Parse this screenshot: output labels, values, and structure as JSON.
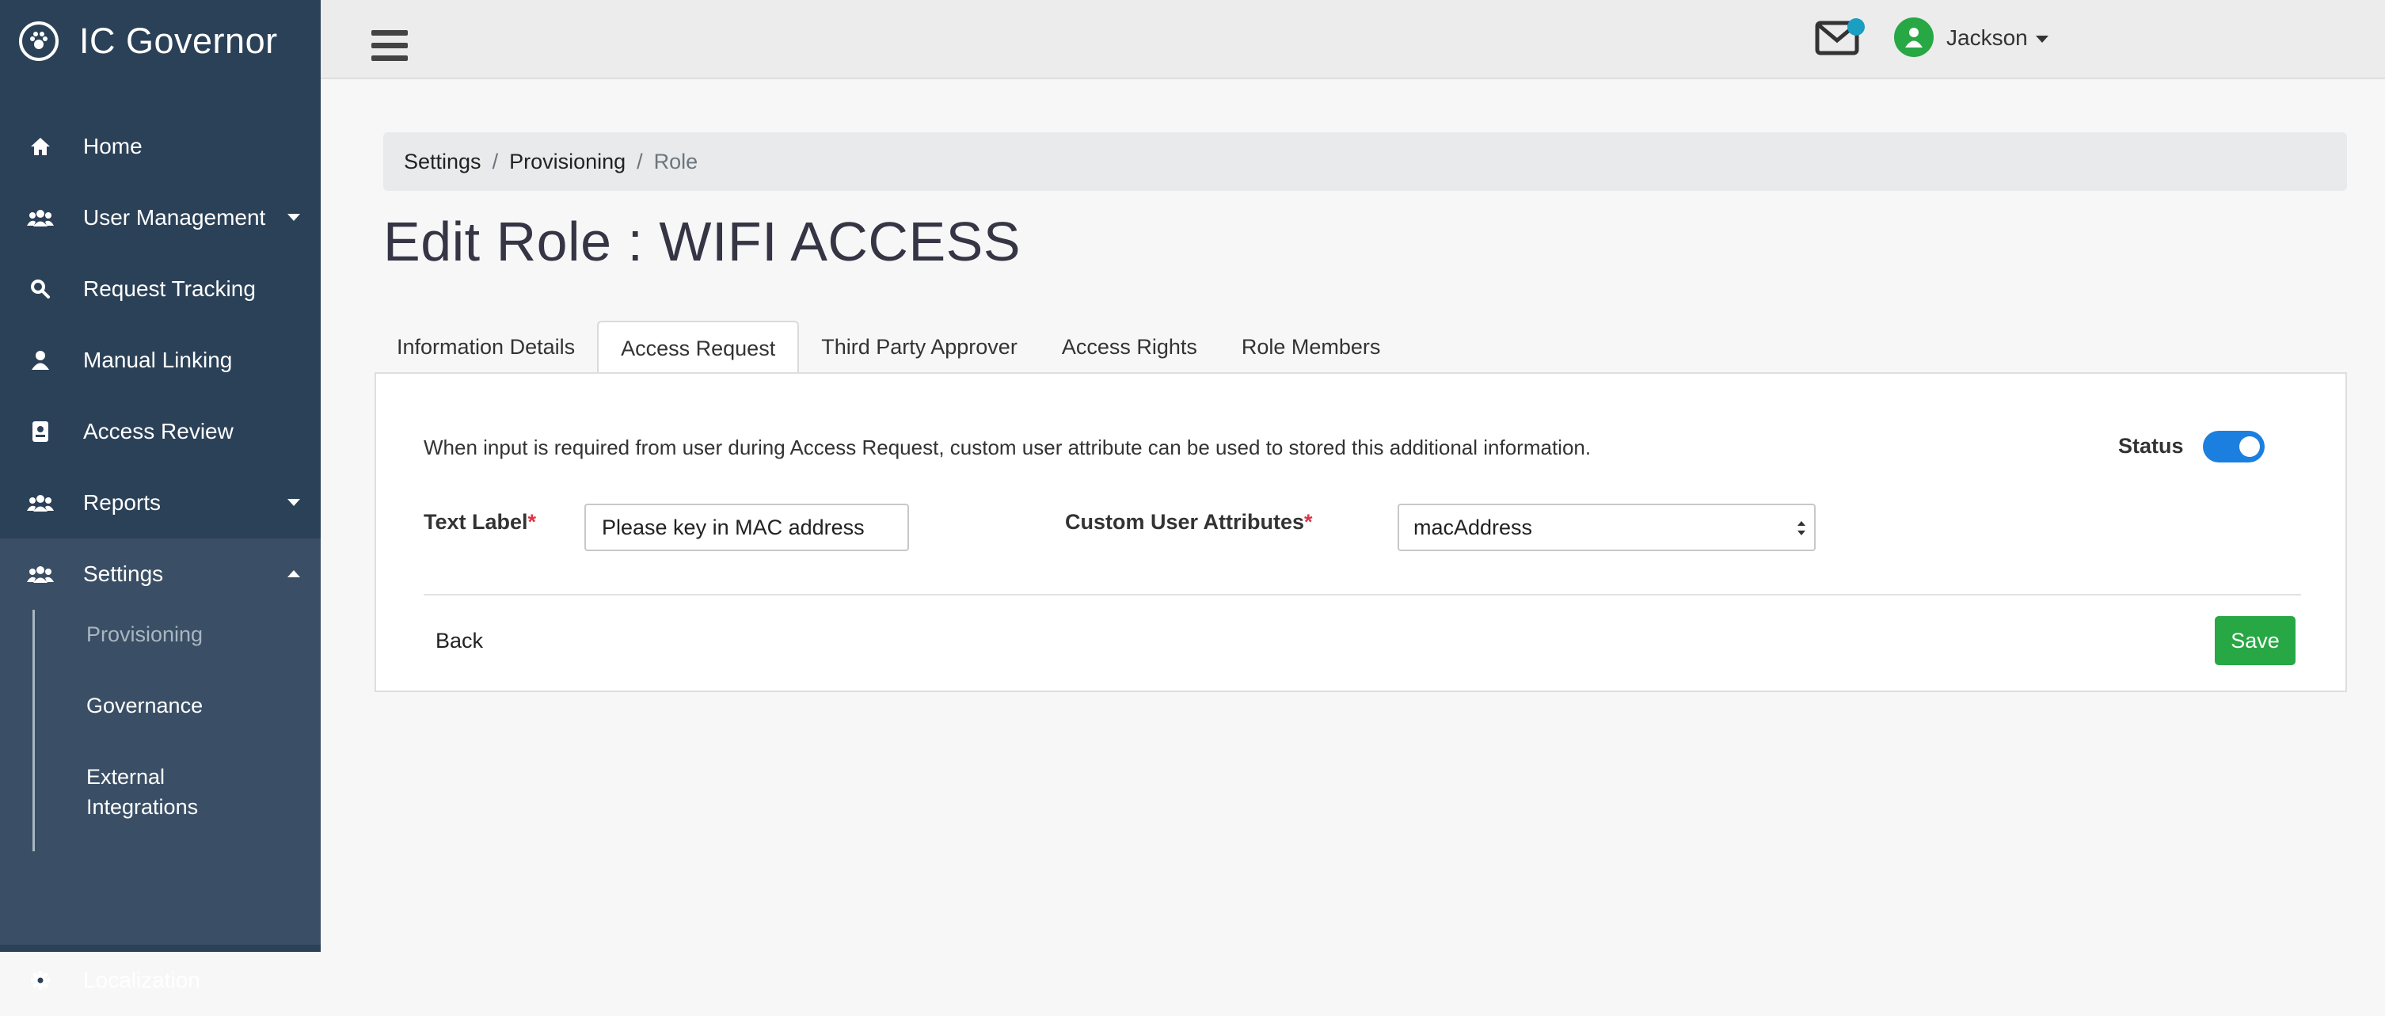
{
  "app": {
    "title": "IC Governor"
  },
  "sidebar": {
    "items": [
      {
        "label": "Home",
        "icon": "home-icon"
      },
      {
        "label": "User Management",
        "icon": "users-icon"
      },
      {
        "label": "Request Tracking",
        "icon": "search-icon"
      },
      {
        "label": "Manual Linking",
        "icon": "user-icon"
      },
      {
        "label": "Access Review",
        "icon": "id-badge-icon"
      },
      {
        "label": "Reports",
        "icon": "users-icon"
      },
      {
        "label": "Settings",
        "icon": "users-icon"
      },
      {
        "label": "Localization",
        "icon": "gear-icon"
      }
    ],
    "settings_sub": [
      "Provisioning",
      "Governance",
      "External",
      "Integrations"
    ]
  },
  "topbar": {
    "user_name": "Jackson"
  },
  "breadcrumb": {
    "items": [
      "Settings",
      "Provisioning",
      "Role"
    ],
    "separator": "/"
  },
  "page": {
    "title": "Edit Role : WIFI ACCESS"
  },
  "tabs": [
    "Information Details",
    "Access Request",
    "Third Party Approver",
    "Access Rights",
    "Role Members"
  ],
  "form": {
    "info_text": "When input is required from user during Access Request, custom user attribute can be used to stored this additional information.",
    "status_label": "Status",
    "status_on": true,
    "text_label": "Text Label",
    "text_value": "Please key in MAC address",
    "attr_label": "Custom User Attributes",
    "attr_value": "macAddress",
    "required_mark": "*",
    "back_label": "Back",
    "save_label": "Save"
  },
  "colors": {
    "sidebar": "#2b4157",
    "accent": "#28a745",
    "toggle": "#1b7fe0",
    "notify_dot": "#1a9ec2"
  }
}
